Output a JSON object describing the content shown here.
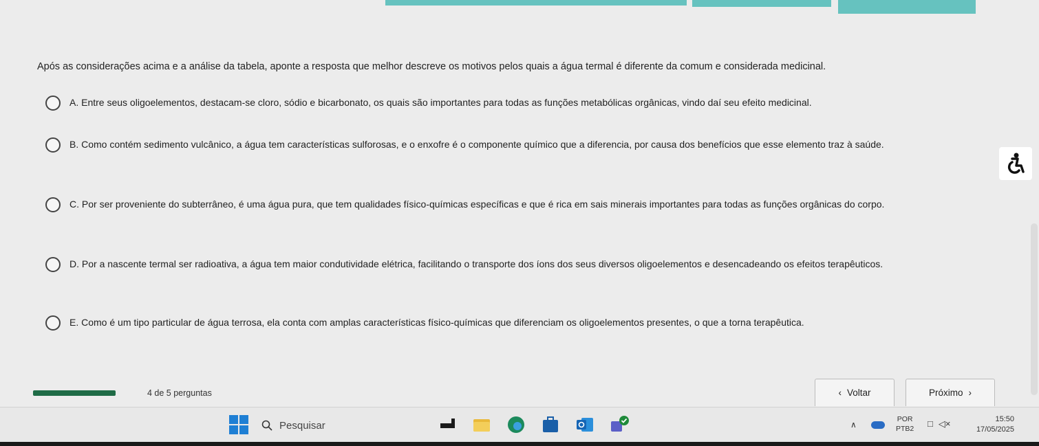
{
  "question": {
    "text": "Após as considerações acima e a análise da tabela, aponte a resposta que melhor descreve os motivos pelos quais a água termal é diferente da comum e considerada medicinal."
  },
  "options": [
    {
      "letter": "A",
      "text": "A. Entre seus oligoelementos, destacam-se cloro, sódio e bicarbonato, os quais são importantes para todas as funções metabólicas orgânicas, vindo daí seu efeito medicinal.",
      "selected": false
    },
    {
      "letter": "B",
      "text": "B. Como contém sedimento vulcânico, a água tem características sulforosas, e o enxofre é o componente químico que a diferencia, por causa dos benefícios que esse elemento traz à saúde.",
      "selected": false
    },
    {
      "letter": "C",
      "text": "C. Por ser proveniente do subterrâneo, é uma água pura, que tem qualidades físico-químicas específicas e que é rica em sais minerais importantes para todas as funções orgânicas do corpo.",
      "selected": false
    },
    {
      "letter": "D",
      "text": "D. Por a nascente termal ser radioativa, a água tem maior condutividade elétrica, facilitando o transporte dos íons dos seus diversos oligoelementos e desencadeando os efeitos terapêuticos.",
      "selected": false
    },
    {
      "letter": "E",
      "text": "E. Como é um tipo particular de água terrosa, ela conta com amplas características físico-químicas que diferenciam os oligoelementos presentes, o que a torna terapêutica.",
      "selected": false
    }
  ],
  "progress": {
    "label": "4 de 5 perguntas",
    "current": 4,
    "total": 5
  },
  "navigation": {
    "back_label": "Voltar",
    "next_label": "Próximo"
  },
  "taskbar": {
    "search_placeholder": "Pesquisar",
    "lang_top": "POR",
    "lang_bottom": "PTB2",
    "time": "15:50",
    "date": "17/05/2025",
    "apps": [
      "terminal-app-icon",
      "file-explorer-icon",
      "edge-browser-icon",
      "store-icon",
      "outlook-icon",
      "teams-icon"
    ]
  },
  "colors": {
    "accent_teal": "#66c2bf",
    "progress_green": "#1f6b46",
    "windows_blue": "#1e7fd4"
  }
}
